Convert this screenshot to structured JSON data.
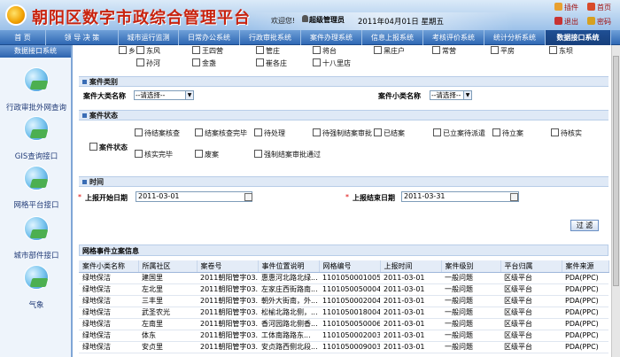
{
  "header": {
    "title": "朝阳区数字市政综合管理平台",
    "welcome": "欢迎您!",
    "user": "超级管理员",
    "date": "2011年04月01日 星期五",
    "links": [
      "插件",
      "首页",
      "退出",
      "密码"
    ]
  },
  "nav": {
    "items": [
      "首 页",
      "领 导 决 策",
      "城市运行监测",
      "日常办公系统",
      "行政审批系统",
      "案件办理系统",
      "信息上报系统",
      "考核评价系统",
      "统计分析系统",
      "数据接口系统"
    ],
    "active": "数据接口系统"
  },
  "sidebar": {
    "heading": "数据接口系统",
    "items": [
      "行政审批外网查询",
      "GIS查询接口",
      "网格平台接口",
      "城市部件接口",
      "气象"
    ]
  },
  "area": {
    "row1": [
      "乡",
      "东风",
      "王四营",
      "管庄",
      "将台",
      "黑庄户",
      "常营",
      "平房",
      "东坝"
    ],
    "row2": [
      "孙河",
      "金盏",
      "崔各庄",
      "十八里店"
    ]
  },
  "category": {
    "section": "案件类别",
    "big_label": "案件大类名称",
    "big_value": "--请选择--",
    "small_label": "案件小类名称",
    "small_value": "--请选择--"
  },
  "status": {
    "section": "案件状态",
    "label": "案件状态",
    "row1": [
      "待结案核查",
      "结案核查完毕",
      "待处理",
      "待强制结案审批",
      "已结案",
      "已立案待派遣",
      "待立案",
      "待核实"
    ],
    "row2": [
      "核实完毕",
      "废案",
      "强制结案审批通过"
    ]
  },
  "time": {
    "section": "时间",
    "start_label": "上报开始日期",
    "start_value": "2011-03-01",
    "end_label": "上报结束日期",
    "end_value": "2011-03-31",
    "filter": "过 滤"
  },
  "table": {
    "title": "网格事件立案信息",
    "columns": [
      "案件小类名称",
      "所属社区",
      "案卷号",
      "事件位置说明",
      "网格编号",
      "上报时间",
      "案件级别",
      "平台归属",
      "案件来源"
    ],
    "rows": [
      [
        "绿地保洁",
        "建国里",
        "2011朝阳管字03...",
        "惠惠河北路北绿...",
        "110105000100527",
        "2011-03-01",
        "一般问题",
        "区级平台",
        "PDA(PPC)"
      ],
      [
        "绿地保洁",
        "左北里",
        "2011朝阳管字03...",
        "左家庄西街路南...",
        "110105005000401",
        "2011-03-01",
        "一般问题",
        "区级平台",
        "PDA(PPC)"
      ],
      [
        "绿地保洁",
        "三丰里",
        "2011朝阳管字03...",
        "朝外大街南，外...",
        "110105000200401",
        "2011-03-01",
        "一般问题",
        "区级平台",
        "PDA(PPC)"
      ],
      [
        "绿地保洁",
        "武圣农光",
        "2011朝阳管字03...",
        "松榆北路北侧，...",
        "110105001800414",
        "2011-03-01",
        "一般问题",
        "区级平台",
        "PDA(PPC)"
      ],
      [
        "绿地保洁",
        "左南里",
        "2011朝阳管字03...",
        "香河园路北侧香...",
        "110105005000612",
        "2011-03-01",
        "一般问题",
        "区级平台",
        "PDA(PPC)"
      ],
      [
        "绿地保洁",
        "体东",
        "2011朝阳管字03...",
        "工体南路路东...",
        "110105000200301",
        "2011-03-01",
        "一般问题",
        "区级平台",
        "PDA(PPC)"
      ],
      [
        "绿地保洁",
        "安贞里",
        "2011朝阳管字03...",
        "安贞路西侧北段...",
        "110105000900301",
        "2011-03-01",
        "一般问题",
        "区级平台",
        "PDA(PPC)"
      ]
    ]
  }
}
